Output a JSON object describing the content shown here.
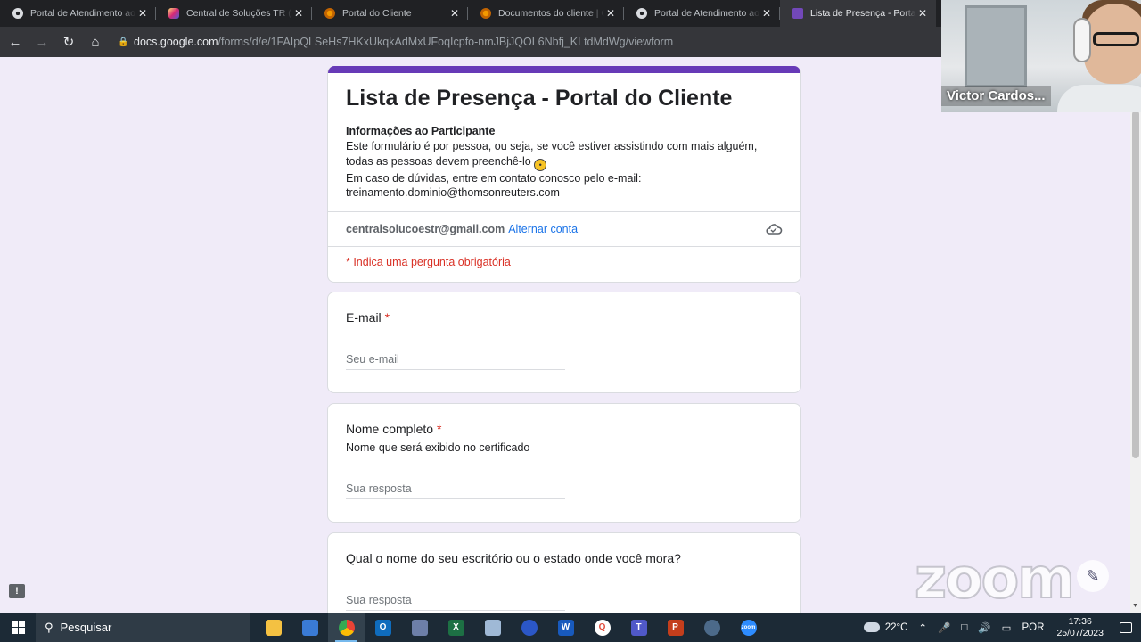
{
  "browser": {
    "tabs": [
      {
        "title": "Portal de Atendimento ao Cliente",
        "icon": "gear-icon",
        "active": false
      },
      {
        "title": "Central de Soluções TR (@centralsolucoestr)",
        "icon": "instagram-icon",
        "active": false
      },
      {
        "title": "Portal do Cliente",
        "icon": "portal-icon",
        "active": false
      },
      {
        "title": "Documentos do cliente | Onvio",
        "icon": "portal-icon",
        "active": false
      },
      {
        "title": "Portal de Atendimento ao Cliente",
        "icon": "gear-icon",
        "active": false
      },
      {
        "title": "Lista de Presença - Portal do Cliente",
        "icon": "google-forms-icon",
        "active": true
      }
    ],
    "url_host": "docs.google.com",
    "url_path": "/forms/d/e/1FAIpQLSeHs7HKxUkqkAdMxUFoqIcpfo-nmJBjJQOL6Nbfj_KLtdMdWg/viewform",
    "close_glyph": "✕"
  },
  "form": {
    "title": "Lista de Presença - Portal do Cliente",
    "info_heading": "Informações ao Participante",
    "info_line1": "Este formulário é por pessoa, ou seja, se você estiver assistindo com mais alguém, todas as pessoas devem preenchê-lo",
    "info_line2": "Em caso de dúvidas, entre em contato conosco pelo e-mail:",
    "info_email": "treinamento.dominio@thomsonreuters.com",
    "account_email": "centralsolucoestr@gmail.com",
    "switch_account": "Alternar conta",
    "required_note": "* Indica uma pergunta obrigatória",
    "accent_color": "#673ab7",
    "required_color": "#d93025"
  },
  "questions": [
    {
      "title": "E-mail",
      "required": "*",
      "help": "",
      "placeholder": "Seu e-mail"
    },
    {
      "title": "Nome completo",
      "required": "*",
      "help": "Nome que será exibido no certificado",
      "placeholder": "Sua resposta"
    },
    {
      "title": "Qual o nome do seu escritório ou o estado onde você mora?",
      "required": "",
      "help": "",
      "placeholder": "Sua resposta"
    }
  ],
  "overlay": {
    "participant_name": "Victor Cardos...",
    "watermark": "zoom"
  },
  "taskbar": {
    "search_label": "Pesquisar",
    "apps": [
      "file-explorer-icon",
      "store-icon",
      "chrome-icon",
      "outlook-icon",
      "snipping-icon",
      "excel-icon",
      "notes-icon",
      "headset-app-icon",
      "word-icon",
      "search-app-icon",
      "teams-icon",
      "powerpoint-icon",
      "remote-icon",
      "zoom-icon"
    ],
    "temperature": "22°C",
    "language": "POR",
    "time": "17:36",
    "date": "25/07/2023"
  }
}
